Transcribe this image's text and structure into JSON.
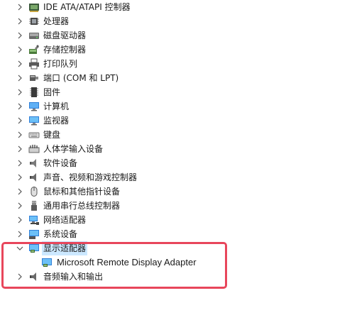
{
  "tree": {
    "items": [
      {
        "label": "IDE ATA/ATAPI 控制器",
        "icon": "ide-controller-icon",
        "expanded": false
      },
      {
        "label": "处理器",
        "icon": "processor-icon",
        "expanded": false
      },
      {
        "label": "磁盘驱动器",
        "icon": "disk-drive-icon",
        "expanded": false
      },
      {
        "label": "存储控制器",
        "icon": "storage-controller-icon",
        "expanded": false
      },
      {
        "label": "打印队列",
        "icon": "printer-icon",
        "expanded": false
      },
      {
        "label": "端口 (COM 和 LPT)",
        "icon": "port-icon",
        "expanded": false
      },
      {
        "label": "固件",
        "icon": "firmware-icon",
        "expanded": false
      },
      {
        "label": "计算机",
        "icon": "computer-icon",
        "expanded": false
      },
      {
        "label": "监视器",
        "icon": "monitor-icon",
        "expanded": false
      },
      {
        "label": "键盘",
        "icon": "keyboard-icon",
        "expanded": false
      },
      {
        "label": "人体学输入设备",
        "icon": "hid-icon",
        "expanded": false
      },
      {
        "label": "软件设备",
        "icon": "software-device-icon",
        "expanded": false
      },
      {
        "label": "声音、视频和游戏控制器",
        "icon": "sound-icon",
        "expanded": false
      },
      {
        "label": "鼠标和其他指针设备",
        "icon": "mouse-icon",
        "expanded": false
      },
      {
        "label": "通用串行总线控制器",
        "icon": "usb-icon",
        "expanded": false
      },
      {
        "label": "网络适配器",
        "icon": "network-adapter-icon",
        "expanded": false
      },
      {
        "label": "系统设备",
        "icon": "system-device-icon",
        "expanded": false
      },
      {
        "label": "显示适配器",
        "icon": "display-adapter-icon",
        "expanded": true,
        "selected": true
      },
      {
        "label": "Microsoft Remote Display Adapter",
        "icon": "display-adapter-icon",
        "child": true
      },
      {
        "label": "音频输入和输出",
        "icon": "audio-io-icon",
        "expanded": false
      }
    ]
  },
  "colors": {
    "selection": "#cce8ff",
    "highlight_border": "#e8465b"
  }
}
